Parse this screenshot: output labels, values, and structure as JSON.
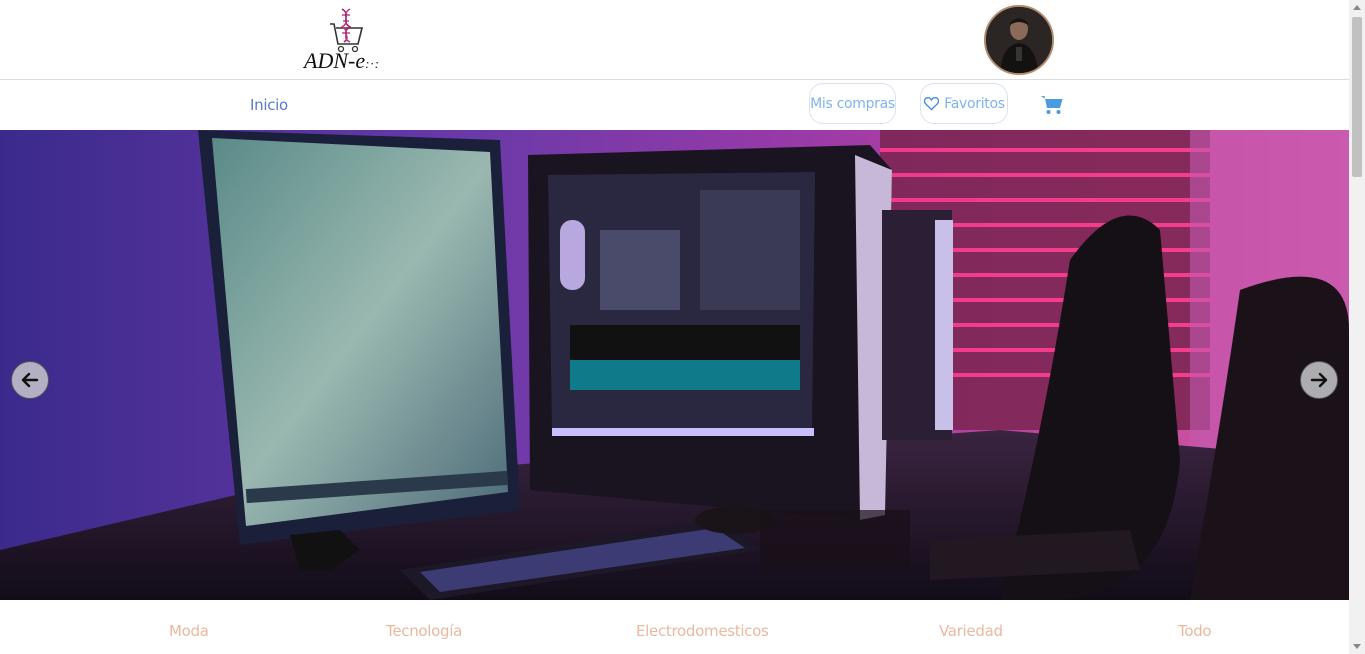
{
  "header": {
    "logo_text": "ADN-e",
    "logo_icon": "dna-cart-icon",
    "avatar_icon": "user-avatar"
  },
  "nav": {
    "home_label": "Inicio",
    "purchases_label": "Mis compras",
    "favorites_label": "Favoritos",
    "favorites_icon": "heart-icon",
    "cart_icon": "shopping-cart-icon"
  },
  "carousel": {
    "image_icon": "gaming-setup-photo",
    "prev_icon": "arrow-left-icon",
    "next_icon": "arrow-right-icon"
  },
  "categories": [
    {
      "label": "Moda"
    },
    {
      "label": "Tecnología"
    },
    {
      "label": "Electrodomesticos"
    },
    {
      "label": "Variedad"
    },
    {
      "label": "Todo"
    }
  ],
  "colors": {
    "nav_link": "#5b79c9",
    "pill_text": "#7fb3ea",
    "cart": "#4a9be0",
    "category_text": "#e9b8a0"
  }
}
